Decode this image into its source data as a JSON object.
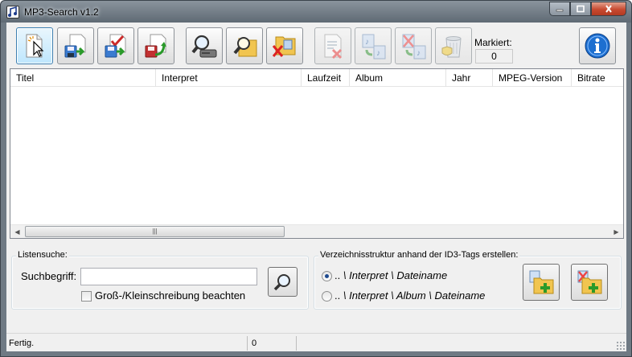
{
  "window": {
    "title": "MP3-Search v1.2"
  },
  "toolbar": {
    "buttons": [
      {
        "name": "new-search-button",
        "icon": "new-document-cursor-icon"
      },
      {
        "name": "save-list-button",
        "icon": "save-disk-icon"
      },
      {
        "name": "save-checked-button",
        "icon": "save-check-icon"
      },
      {
        "name": "save-selected-button",
        "icon": "save-arrow-icon"
      },
      {
        "name": "search-drive-button",
        "icon": "magnifier-drive-icon"
      },
      {
        "name": "search-folder-button",
        "icon": "magnifier-folder-icon"
      },
      {
        "name": "remove-folder-button",
        "icon": "folder-delete-icon"
      },
      {
        "name": "clear-list-button",
        "icon": "list-delete-icon"
      },
      {
        "name": "copy-files-button",
        "icon": "copy-music-icon"
      },
      {
        "name": "move-files-button",
        "icon": "move-music-icon"
      },
      {
        "name": "delete-files-button",
        "icon": "recycle-bin-icon"
      },
      {
        "name": "info-button",
        "icon": "info-icon"
      }
    ],
    "markiert_label": "Markiert:",
    "markiert_value": "0"
  },
  "list": {
    "columns": [
      "Titel",
      "Interpret",
      "Laufzeit",
      "Album",
      "Jahr",
      "MPEG-Version",
      "Bitrate"
    ],
    "rows": []
  },
  "listsuche": {
    "title": "Listensuche:",
    "suchbegriff_label": "Suchbegriff:",
    "suchbegriff_value": "",
    "case_label": "Groß-/Kleinschreibung beachten",
    "case_checked": false
  },
  "verzeichnis": {
    "title": "Verzeichnisstruktur anhand der ID3-Tags erstellen:",
    "option1_prefix": "..",
    "option1_path": "\\ Interpret \\ Dateiname",
    "option2_prefix": "..",
    "option2_path": "\\ Interpret \\ Album \\ Dateiname",
    "selected": 1
  },
  "status": {
    "text": "Fertig.",
    "count": "0"
  },
  "colors": {
    "accent": "#3c7fb1",
    "close": "#c84a30"
  }
}
